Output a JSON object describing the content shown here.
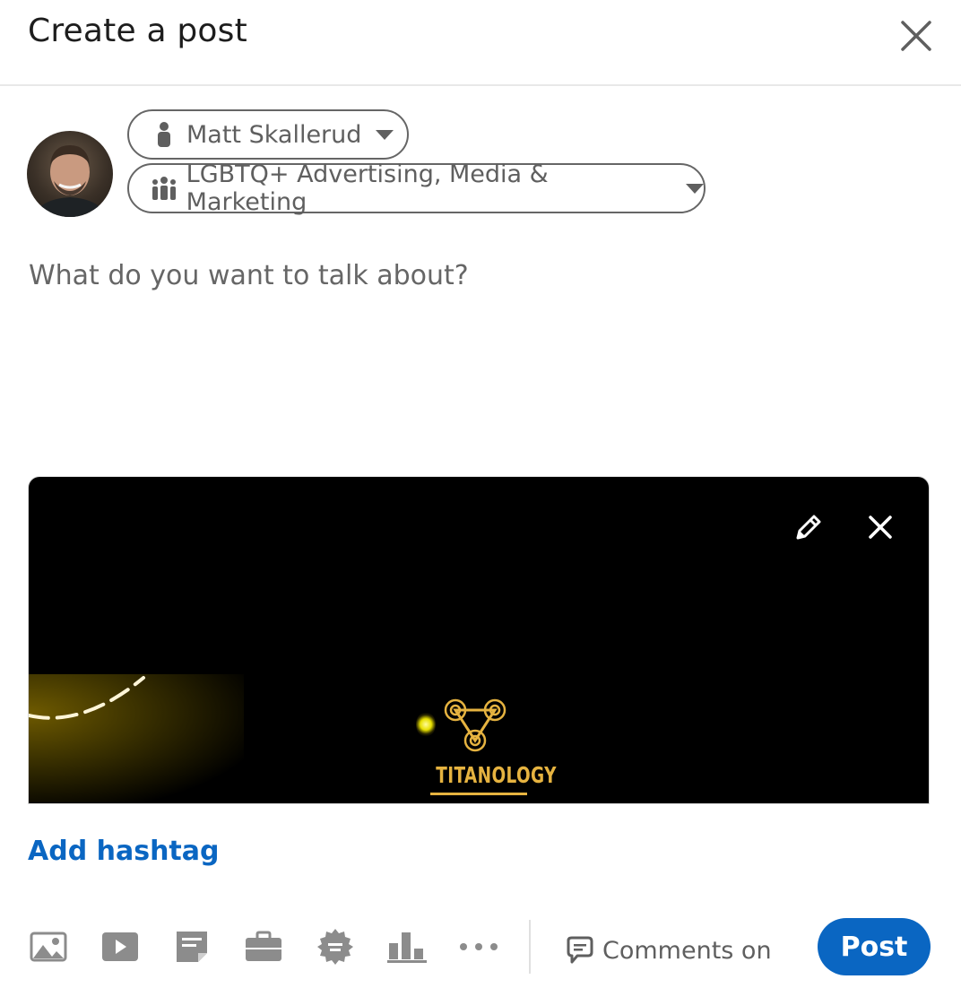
{
  "header": {
    "title": "Create a post"
  },
  "author": {
    "name": "Matt Skallerud"
  },
  "audience": {
    "label": "LGBTQ+ Advertising, Media & Marketing"
  },
  "composer": {
    "placeholder": "What do you want to talk about?"
  },
  "media": {
    "logo_text": "TITANOLOGY"
  },
  "hashtag": {
    "label": "Add hashtag"
  },
  "footer": {
    "comments_label": "Comments on",
    "post_label": "Post"
  },
  "colors": {
    "accent": "#0a66c2",
    "icon_gray": "#8c8c8c",
    "logo_gold": "#e6b340"
  }
}
